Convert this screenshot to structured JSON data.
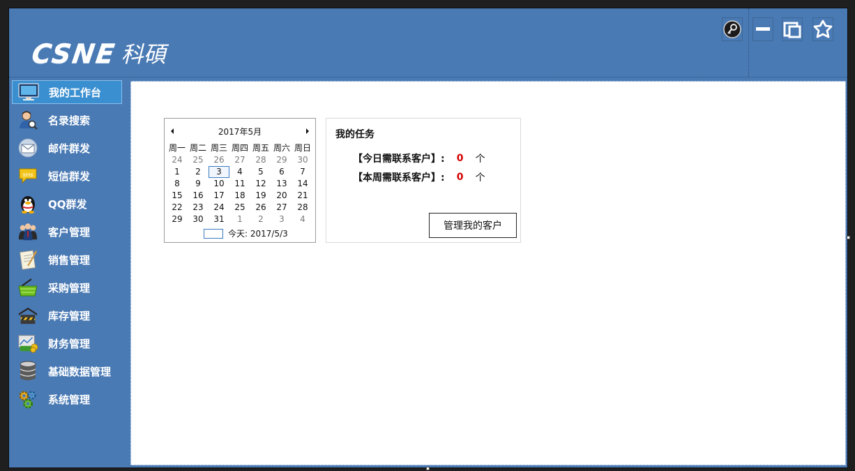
{
  "header": {
    "logo_latin": "CSNE",
    "logo_cn": "科碩",
    "buttons": [
      {
        "icon": "key-icon"
      },
      {
        "icon": "minimize-icon"
      },
      {
        "icon": "restore-icon"
      },
      {
        "icon": "pin-icon"
      }
    ]
  },
  "sidebar": {
    "items": [
      {
        "label": "我的工作台",
        "icon": "monitor-icon",
        "active": true
      },
      {
        "label": "名录搜索",
        "icon": "user-search-icon"
      },
      {
        "label": "邮件群发",
        "icon": "mail-icon"
      },
      {
        "label": "短信群发",
        "icon": "sms-icon"
      },
      {
        "label": "QQ群发",
        "icon": "qq-penguin-icon"
      },
      {
        "label": "客户管理",
        "icon": "customers-icon"
      },
      {
        "label": "销售管理",
        "icon": "notepad-icon"
      },
      {
        "label": "采购管理",
        "icon": "basket-icon"
      },
      {
        "label": "库存管理",
        "icon": "warehouse-icon"
      },
      {
        "label": "财务管理",
        "icon": "finance-icon"
      },
      {
        "label": "基础数据管理",
        "icon": "database-icon"
      },
      {
        "label": "系统管理",
        "icon": "gears-icon"
      }
    ]
  },
  "calendar": {
    "month_label": "2017年5月",
    "weekdays": [
      "周一",
      "周二",
      "周三",
      "周四",
      "周五",
      "周六",
      "周日"
    ],
    "weeks": [
      [
        [
          "24",
          1
        ],
        [
          "25",
          1
        ],
        [
          "26",
          1
        ],
        [
          "27",
          1
        ],
        [
          "28",
          1
        ],
        [
          "29",
          1
        ],
        [
          "30",
          1
        ]
      ],
      [
        [
          "1",
          0
        ],
        [
          "2",
          0
        ],
        [
          "3",
          2
        ],
        [
          "4",
          0
        ],
        [
          "5",
          0
        ],
        [
          "6",
          0
        ],
        [
          "7",
          0
        ]
      ],
      [
        [
          "8",
          0
        ],
        [
          "9",
          0
        ],
        [
          "10",
          0
        ],
        [
          "11",
          0
        ],
        [
          "12",
          0
        ],
        [
          "13",
          0
        ],
        [
          "14",
          0
        ]
      ],
      [
        [
          "15",
          0
        ],
        [
          "16",
          0
        ],
        [
          "17",
          0
        ],
        [
          "18",
          0
        ],
        [
          "19",
          0
        ],
        [
          "20",
          0
        ],
        [
          "21",
          0
        ]
      ],
      [
        [
          "22",
          0
        ],
        [
          "23",
          0
        ],
        [
          "24",
          0
        ],
        [
          "25",
          0
        ],
        [
          "26",
          0
        ],
        [
          "27",
          0
        ],
        [
          "28",
          0
        ]
      ],
      [
        [
          "29",
          0
        ],
        [
          "30",
          0
        ],
        [
          "31",
          0
        ],
        [
          "1",
          1
        ],
        [
          "2",
          1
        ],
        [
          "3",
          1
        ],
        [
          "4",
          1
        ]
      ]
    ],
    "today_label": "今天: 2017/5/3"
  },
  "tasks": {
    "title": "我的任务",
    "rows": [
      {
        "label": "【今日需联系客户】:",
        "count": "0",
        "unit": "个"
      },
      {
        "label": "【本周需联系客户】:",
        "count": "0",
        "unit": "个"
      }
    ],
    "manage_button": "管理我的客户"
  }
}
